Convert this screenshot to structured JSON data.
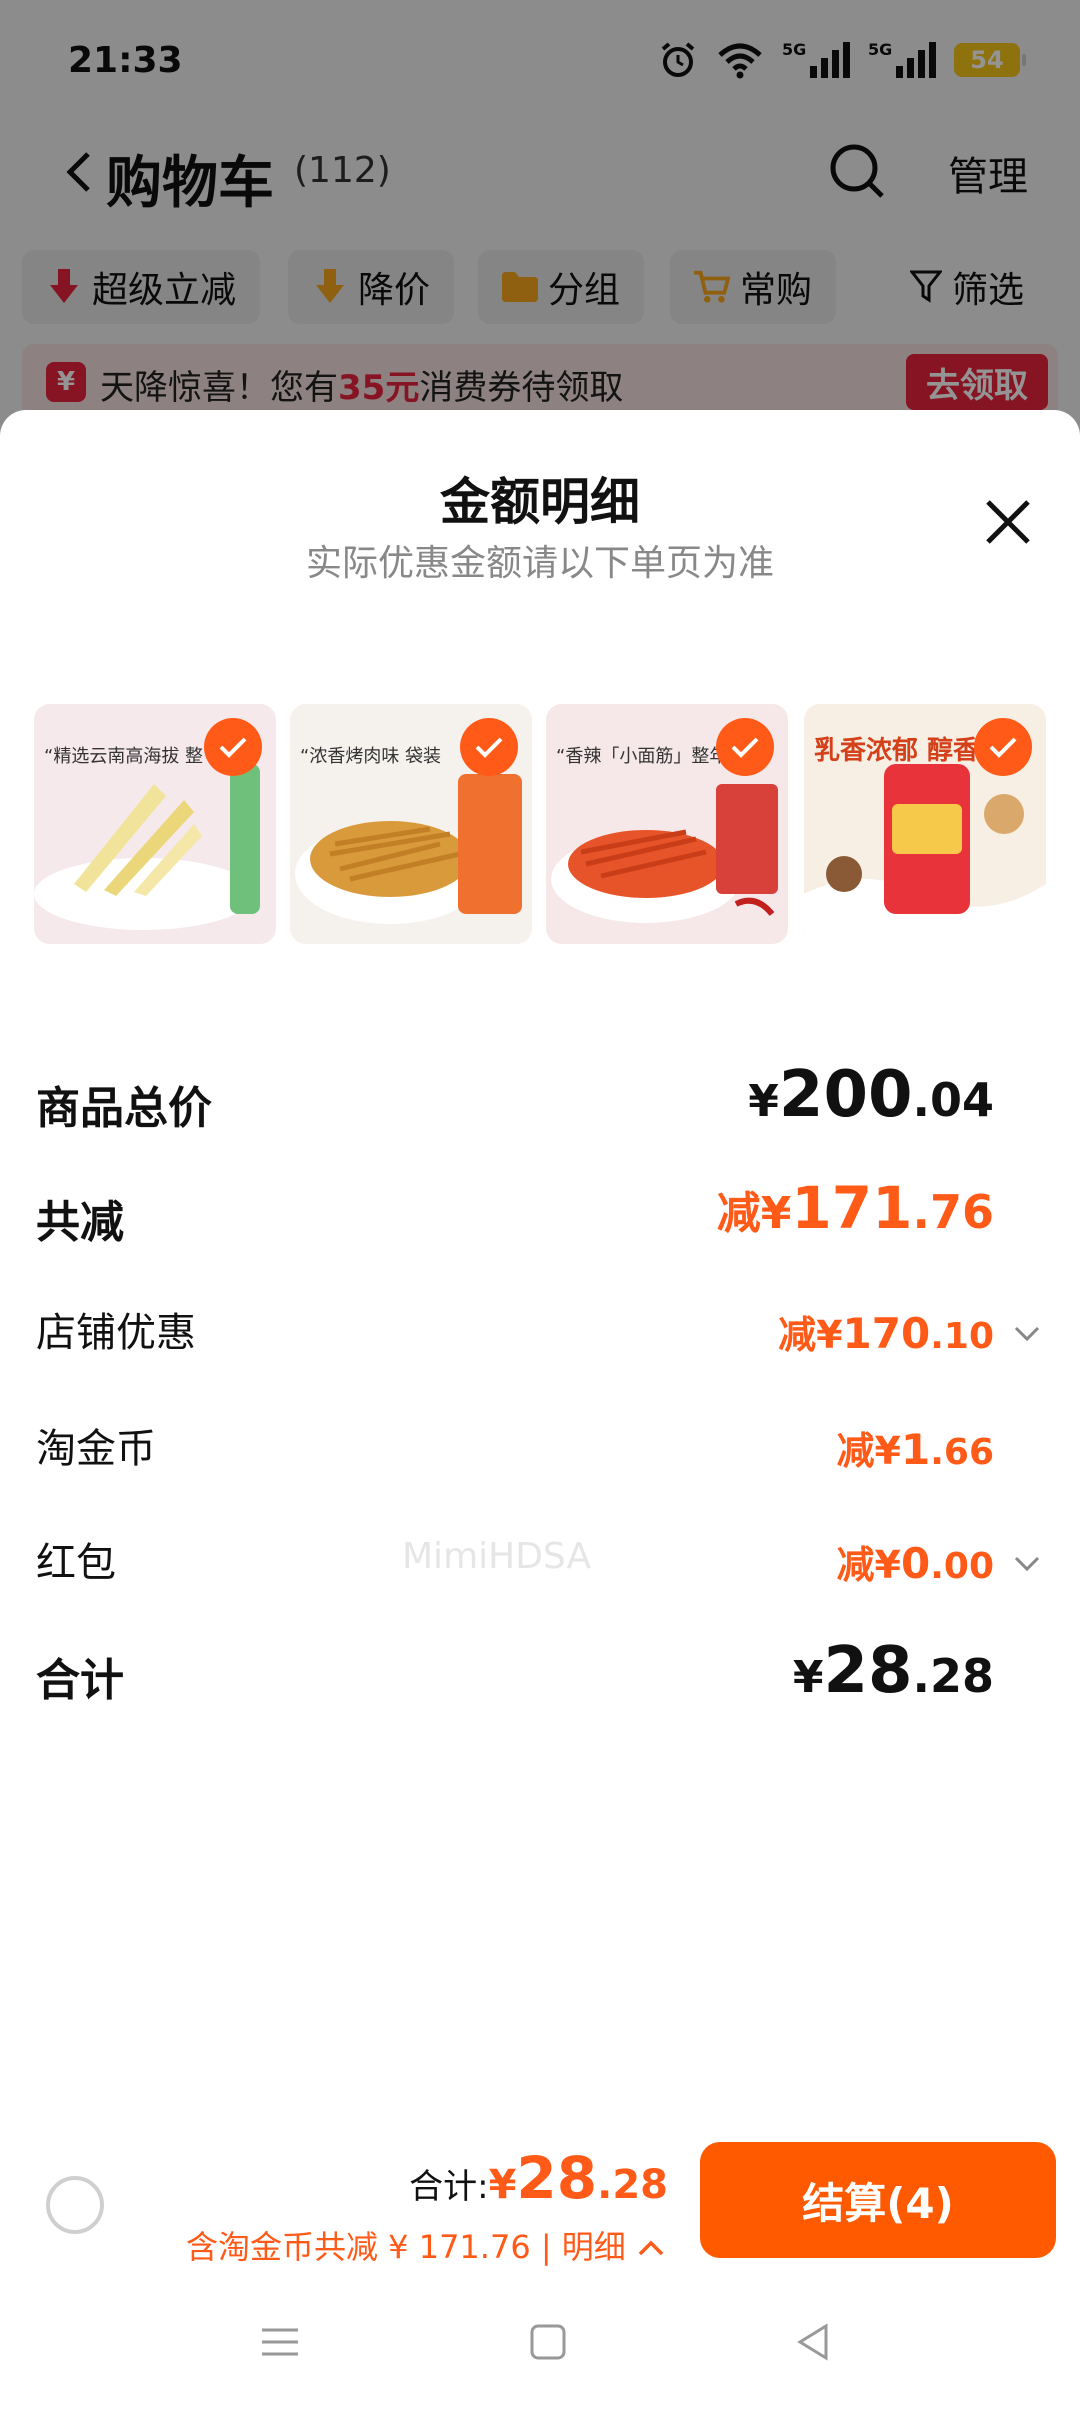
{
  "status_bar": {
    "time": "21:33",
    "signal_tag": "5G",
    "battery": "54"
  },
  "header": {
    "title": "购物车",
    "count": "(112)",
    "manage": "管理"
  },
  "chips": [
    {
      "label": "超级立减",
      "icon": "arrow-down-red-icon"
    },
    {
      "label": "降价",
      "icon": "arrow-down-orange-icon"
    },
    {
      "label": "分组",
      "icon": "folder-icon"
    },
    {
      "label": "常购",
      "icon": "cart-icon"
    }
  ],
  "filter_label": "筛选",
  "promo": {
    "yen": "¥",
    "prefix": "天降惊喜！您有",
    "amount": "35元",
    "suffix": "消费券待领取",
    "button": "去领取"
  },
  "sheet": {
    "title": "金额明细",
    "subtitle": "实际优惠金额请以下单页为准",
    "products": [
      {
        "caption": "“精选云南高海拔 整",
        "selected": true
      },
      {
        "caption": "“浓香烤肉味 袋装",
        "selected": true
      },
      {
        "caption": "“香辣「小面筋」整年",
        "selected": true
      },
      {
        "caption": "乳香浓郁 醇香",
        "selected": true
      }
    ],
    "rows": {
      "subtotal": {
        "label": "商品总价",
        "yen": "¥",
        "int": "200",
        "dec": ".04"
      },
      "total_discount": {
        "label": "共减",
        "prefix": "减¥",
        "int": "171",
        "dec": ".76"
      },
      "shop_discount": {
        "label": "店铺优惠",
        "prefix": "减¥",
        "int": "170",
        "dec": ".10"
      },
      "coins": {
        "label": "淘金币",
        "prefix": "减¥",
        "int": "1",
        "dec": ".66"
      },
      "red_packet": {
        "label": "红包",
        "prefix": "减¥",
        "int": "0",
        "dec": ".00"
      },
      "total": {
        "label": "合计",
        "yen": "¥",
        "int": "28",
        "dec": ".28"
      }
    },
    "watermark": "MimiHDSA"
  },
  "checkout": {
    "total_label": "合计:",
    "yen": "¥",
    "int": "28",
    "dec": ".28",
    "detail": "含淘金币共减 ¥ 171.76 | 明细",
    "button": "结算(4)"
  },
  "colors": {
    "accent": "#ff5a17",
    "promo_red": "#e8233d",
    "pay_button": "#ff5a00"
  }
}
